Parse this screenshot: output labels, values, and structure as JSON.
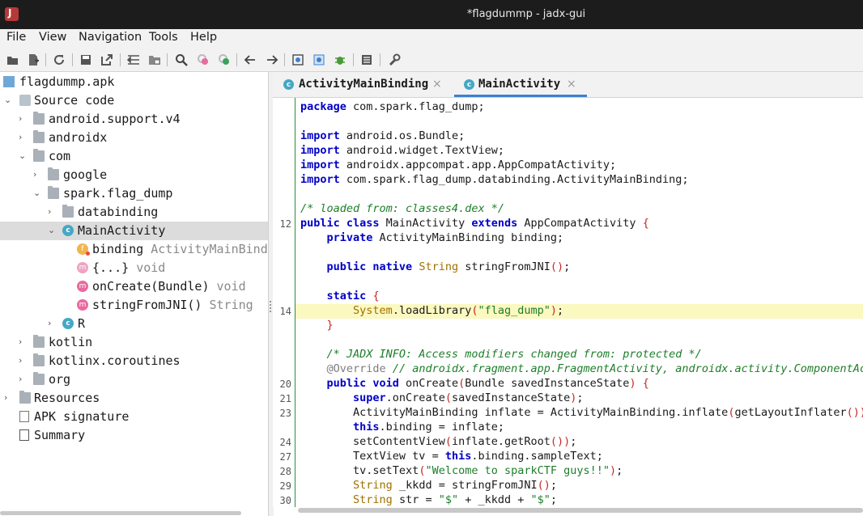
{
  "window": {
    "title": "*flagdummp - jadx-gui"
  },
  "menu": [
    "File",
    "View",
    "Navigation",
    "Tools",
    "Help"
  ],
  "toolbar_icons": [
    "open-file-icon",
    "add-files-icon",
    "sync-icon",
    "save-all-icon",
    "export-icon",
    "sync-tree-icon",
    "flatten-packages-icon",
    "search-icon",
    "find-class-icon",
    "find-usage-icon",
    "back-icon",
    "forward-icon",
    "deobfuscation-icon",
    "quark-icon",
    "debugger-icon",
    "log-icon",
    "preferences-icon"
  ],
  "tree": {
    "root": "flagdummp.apk",
    "source_code": "Source code",
    "pkg_support": "android.support.v4",
    "pkg_androidx": "androidx",
    "pkg_com": "com",
    "pkg_google": "google",
    "pkg_spark": "spark.flag_dump",
    "pkg_databinding": "databinding",
    "cls_main": "MainActivity",
    "field_binding": "binding",
    "field_binding_type": "ActivityMainBind",
    "method_clinit": "{...}",
    "method_clinit_type": "void",
    "method_oncreate": "onCreate(Bundle)",
    "method_oncreate_type": "void",
    "method_jni": "stringFromJNI()",
    "method_jni_type": "String",
    "cls_r": "R",
    "pkg_kotlin": "kotlin",
    "pkg_kotlinx": "kotlinx.coroutines",
    "pkg_org": "org",
    "resources": "Resources",
    "apk_signature": "APK signature",
    "summary": "Summary"
  },
  "tabs": [
    {
      "label": "ActivityMainBinding",
      "active": false
    },
    {
      "label": "MainActivity",
      "active": true
    }
  ],
  "code": {
    "line_numbers": [
      "12",
      "14",
      "20",
      "21",
      "23",
      "24",
      "27",
      "28",
      "29",
      "30"
    ],
    "l1": [
      "package",
      " com.spark.flag_dump;"
    ],
    "l3": [
      "import",
      " android.os.Bundle;"
    ],
    "l4": [
      "import",
      " android.widget.TextView;"
    ],
    "l5": [
      "import",
      " androidx.appcompat.app.AppCompatActivity;"
    ],
    "l6": [
      "import",
      " com.spark.flag_dump.databinding.ActivityMainBinding;"
    ],
    "l8": "/* loaded from: classes4.dex */",
    "l9": [
      "public class",
      " MainActivity ",
      "extends",
      " AppCompatActivity ",
      "{"
    ],
    "l10": [
      "    ",
      "private",
      " ActivityMainBinding binding;"
    ],
    "l12": [
      "    ",
      "public native",
      " ",
      "String",
      " stringFromJNI",
      "()",
      ";"
    ],
    "l14": [
      "    ",
      "static",
      " ",
      "{"
    ],
    "l15": [
      "        ",
      "System",
      ".loadLibrary",
      "(",
      "\"flag_dump\"",
      ")",
      ";"
    ],
    "l16": [
      "    ",
      "}"
    ],
    "l18": "    /* JADX INFO: Access modifiers changed from: protected */",
    "l19": [
      "    ",
      "@Override",
      " ",
      "// androidx.fragment.app.FragmentActivity, androidx.activity.ComponentActivity"
    ],
    "l20": [
      "    ",
      "public void",
      " onCreate",
      "(",
      "Bundle",
      " savedInstanceState",
      ")",
      " ",
      "{"
    ],
    "l21": [
      "        ",
      "super",
      ".onCreate",
      "(",
      "savedInstanceState",
      ")",
      ";"
    ],
    "l22": [
      "        ",
      "ActivityMainBinding inflate = ActivityMainBinding.inflate",
      "(",
      "getLayoutInflater",
      "()",
      ")",
      ";"
    ],
    "l23": [
      "        ",
      "this",
      ".binding = inflate;"
    ],
    "l24": [
      "        ",
      "setContentView",
      "(",
      "inflate.getRoot",
      "()",
      ")",
      ";"
    ],
    "l25": [
      "        ",
      "TextView tv = ",
      "this",
      ".binding.sampleText;"
    ],
    "l26": [
      "        ",
      "tv.setText",
      "(",
      "\"Welcome to sparkCTF guys!!\"",
      ")",
      ";"
    ],
    "l27": [
      "        ",
      "String",
      " _kkdd = stringFromJNI",
      "()",
      ";"
    ],
    "l28": [
      "        ",
      "String",
      " str = ",
      "\"$\"",
      " + _kkdd + ",
      "\"$\"",
      ";"
    ]
  }
}
